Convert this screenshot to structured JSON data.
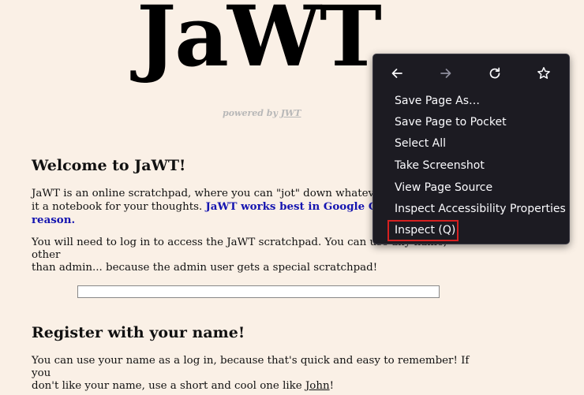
{
  "site": {
    "logo": "JaWT",
    "powered_prefix": "powered by ",
    "powered_link": "JWT"
  },
  "welcome": {
    "heading": "Welcome to JaWT!",
    "intro_start": " JaWT is an online scratchpad, where you can \"jot\" down whatever",
    "intro_line2": "it a notebook for your thoughts. ",
    "intro_highlight_1": "JaWT works best in Google Chr",
    "intro_highlight_2": "reason.",
    "login_note_1": " You will need to log in to access the JaWT scratchpad. You can use any name, other",
    "login_note_2": "than admin... because the admin user gets a special scratchpad!"
  },
  "name_input": {
    "value": ""
  },
  "register": {
    "heading": "Register with your name!",
    "text_1": " You can use your name as a log in, because that's quick and easy to remember! If you",
    "text_2": "don't like your name, use a short and cool one like ",
    "example_name": "John",
    "text_end": "!"
  },
  "context_menu": {
    "nav": [
      "back-icon",
      "forward-icon",
      "reload-icon",
      "bookmark-star-icon"
    ],
    "items": [
      "Save Page As…",
      "Save Page to Pocket",
      "Select All",
      "Take Screenshot",
      "View Page Source",
      "Inspect Accessibility Properties",
      "Inspect (Q)"
    ],
    "highlight_color": "#d62020",
    "bg_color": "#1c1b22"
  }
}
